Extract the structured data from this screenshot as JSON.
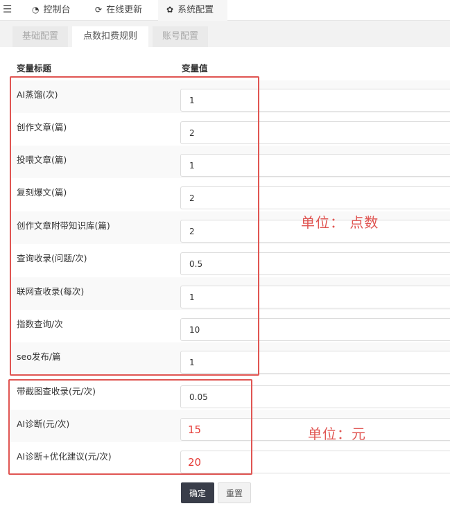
{
  "topnav": {
    "items": [
      {
        "icon": "dashboard-icon",
        "glyph": "◔",
        "label": "控制台"
      },
      {
        "icon": "refresh-icon",
        "glyph": "⟳",
        "label": "在线更新"
      },
      {
        "icon": "gear-icon",
        "glyph": "✿",
        "label": "系统配置"
      }
    ]
  },
  "tabs": [
    "基础配置",
    "点数扣费规则",
    "账号配置"
  ],
  "table": {
    "header_title": "变量标题",
    "header_value": "变量值",
    "rows": [
      {
        "label": "AI蒸馏(次)",
        "value": "1"
      },
      {
        "label": "创作文章(篇)",
        "value": "2"
      },
      {
        "label": "投喂文章(篇)",
        "value": "1"
      },
      {
        "label": "复刻爆文(篇)",
        "value": "2"
      },
      {
        "label": "创作文章附带知识库(篇)",
        "value": "2"
      },
      {
        "label": "查询收录(问题/次)",
        "value": "0.5"
      },
      {
        "label": "联网查收录(每次)",
        "value": "1"
      },
      {
        "label": "指数查询/次",
        "value": "10"
      },
      {
        "label": "seo发布/篇",
        "value": "1"
      },
      {
        "label": "带截图查收录(元/次)",
        "value": "0.05"
      },
      {
        "label": "AI诊断(元/次)",
        "value": "15"
      },
      {
        "label": "AI诊断+优化建议(元/次)",
        "value": "20"
      }
    ]
  },
  "annotations": {
    "points_unit": "单位： 点数",
    "yuan_unit": "单位：元",
    "color": "#e05552"
  },
  "buttons": {
    "confirm": "确定",
    "reset": "重置"
  }
}
